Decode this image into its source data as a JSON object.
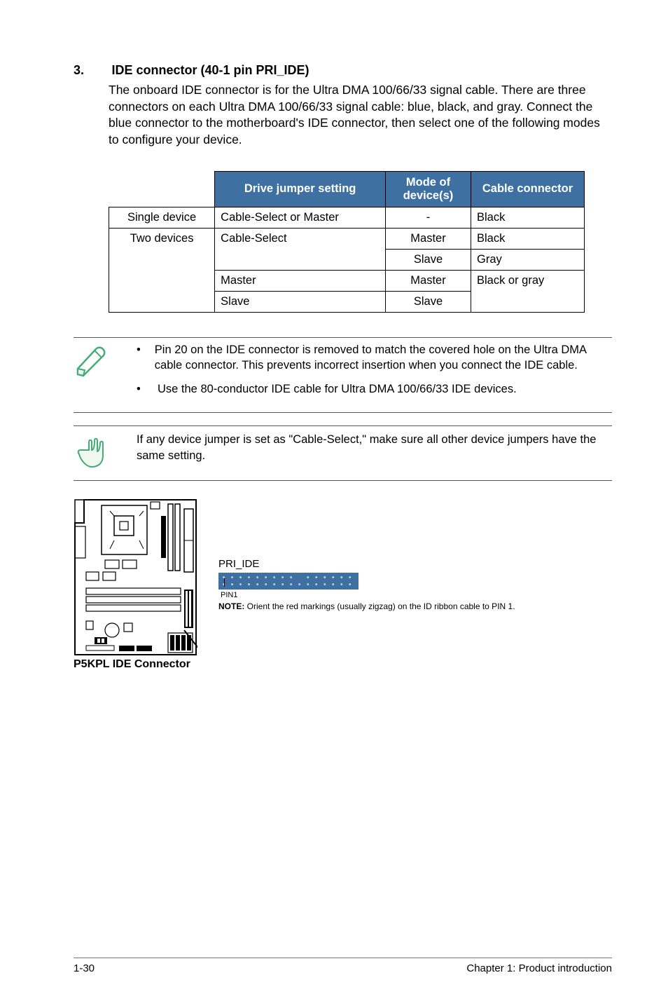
{
  "section": {
    "number": "3.",
    "heading": "IDE connector (40-1 pin PRI_IDE)",
    "body": "The onboard IDE connector is for the Ultra DMA 100/66/33 signal cable. There are three connectors on each Ultra DMA 100/66/33 signal cable: blue, black, and gray. Connect the blue connector to the motherboard's IDE connector, then select one of the following modes to configure your device."
  },
  "table": {
    "headers": [
      "Drive jumper setting",
      "Mode of device(s)",
      "Cable connector"
    ],
    "row_labels": [
      "Single device",
      "Two devices"
    ],
    "rows": [
      {
        "jumper": "Cable-Select or Master",
        "mode": "-",
        "cable": "Black"
      },
      {
        "jumper": "Cable-Select",
        "mode": "Master",
        "cable": "Black"
      },
      {
        "mode": "Slave",
        "cable": "Gray"
      },
      {
        "jumper": "Master",
        "mode": "Master",
        "cable": "Black or gray"
      },
      {
        "jumper": "Slave",
        "mode": "Slave"
      }
    ]
  },
  "note1": {
    "item1": "Pin 20 on the IDE connector is removed to match the covered hole on the Ultra DMA cable connector. This prevents incorrect insertion when you connect the IDE cable.",
    "item2": "Use the 80-conductor IDE cable for Ultra DMA 100/66/33 IDE devices."
  },
  "note2": {
    "text": "If any device jumper is set as \"Cable-Select,\" make sure all other device jumpers have the same setting."
  },
  "diagram": {
    "mobo_label": "P5KPL IDE Connector",
    "ide_label": "PRI_IDE",
    "pin1": "PIN1",
    "note_bold": "NOTE:",
    "note_rest": " Orient the red markings (usually zigzag) on the ID ribbon cable to PIN 1."
  },
  "footer": {
    "left": "1-30",
    "right": "Chapter 1: Product introduction"
  }
}
